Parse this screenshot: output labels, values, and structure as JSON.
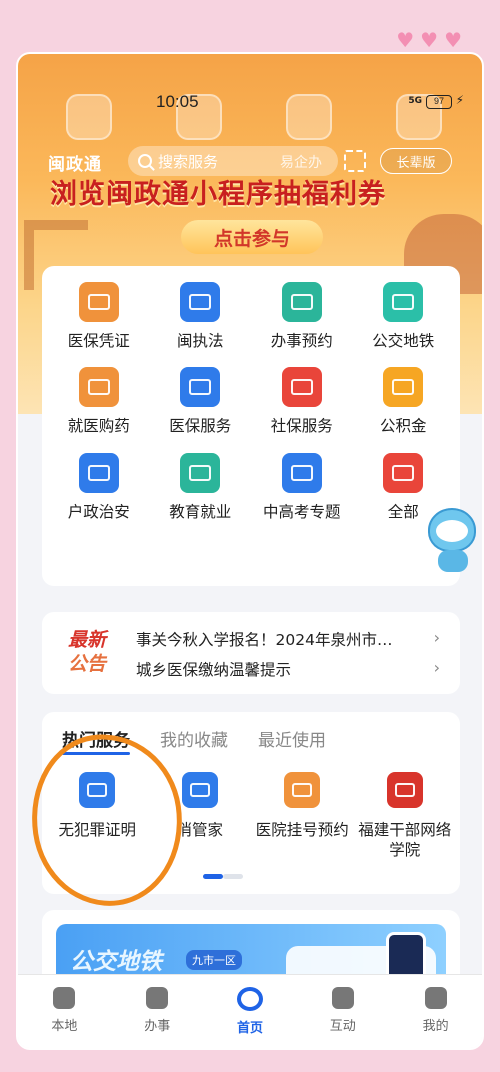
{
  "colors": {
    "accent": "#1f63e6",
    "promo_red": "#c8201f",
    "annotation_orange": "#f08a1c"
  },
  "status_bar": {
    "time": "10:05",
    "network": "5G",
    "battery": "97"
  },
  "header": {
    "logo": "闽政通",
    "search_placeholder": "搜索服务",
    "extra_text": "易企办",
    "elder_label": "长辈版"
  },
  "promo": {
    "title": "浏览闽政通小程序抽福利券",
    "button": "点击参与"
  },
  "services": [
    {
      "label": "医保凭证",
      "icon": "medical-card-icon",
      "color": "#f0923b"
    },
    {
      "label": "闽执法",
      "icon": "law-badge-icon",
      "color": "#2f7bea"
    },
    {
      "label": "办事预约",
      "icon": "calendar-check-icon",
      "color": "#2bb59a"
    },
    {
      "label": "公交地铁",
      "icon": "bus-icon",
      "color": "#2bbfa8"
    },
    {
      "label": "就医购药",
      "icon": "hospital-icon",
      "color": "#f0923b"
    },
    {
      "label": "医保服务",
      "icon": "medical-plus-icon",
      "color": "#2f7bea"
    },
    {
      "label": "社保服务",
      "icon": "hands-heart-icon",
      "color": "#e9453a"
    },
    {
      "label": "公积金",
      "icon": "wallet-yen-icon",
      "color": "#f6a623"
    },
    {
      "label": "户政治安",
      "icon": "police-cap-icon",
      "color": "#2f7bea"
    },
    {
      "label": "教育就业",
      "icon": "graduation-cap-icon",
      "color": "#2bb59a"
    },
    {
      "label": "中高考专题",
      "icon": "exam-cap-icon",
      "color": "#2f7bea"
    },
    {
      "label": "全部",
      "icon": "grid-all-icon",
      "color": "#e9453a"
    }
  ],
  "notice": {
    "logo_line1": "最新",
    "logo_line2": "公告",
    "items": [
      "事关今秋入学报名！2024年泉州市…",
      "城乡医保缴纳温馨提示"
    ]
  },
  "hot": {
    "tabs": [
      "热门服务",
      "我的收藏",
      "最近使用"
    ],
    "items": [
      {
        "label": "无犯罪证明",
        "icon": "no-crime-certificate-icon",
        "color": "#2f7bea"
      },
      {
        "label": "消管家",
        "icon": "fire-house-icon",
        "color": "#2f7bea"
      },
      {
        "label": "医院挂号预约",
        "icon": "hospital-register-icon",
        "color": "#f0923b"
      },
      {
        "label": "福建干部网络学院",
        "icon": "party-emblem-icon",
        "color": "#d8342b"
      }
    ]
  },
  "bus_banner": {
    "title": "公交地铁",
    "tag": "九市一区"
  },
  "tabbar": [
    {
      "label": "本地",
      "icon": "location-icon"
    },
    {
      "label": "办事",
      "icon": "service-house-icon"
    },
    {
      "label": "首页",
      "icon": "home-logo-icon"
    },
    {
      "label": "互动",
      "icon": "hotline-12345-icon"
    },
    {
      "label": "我的",
      "icon": "person-icon"
    }
  ]
}
